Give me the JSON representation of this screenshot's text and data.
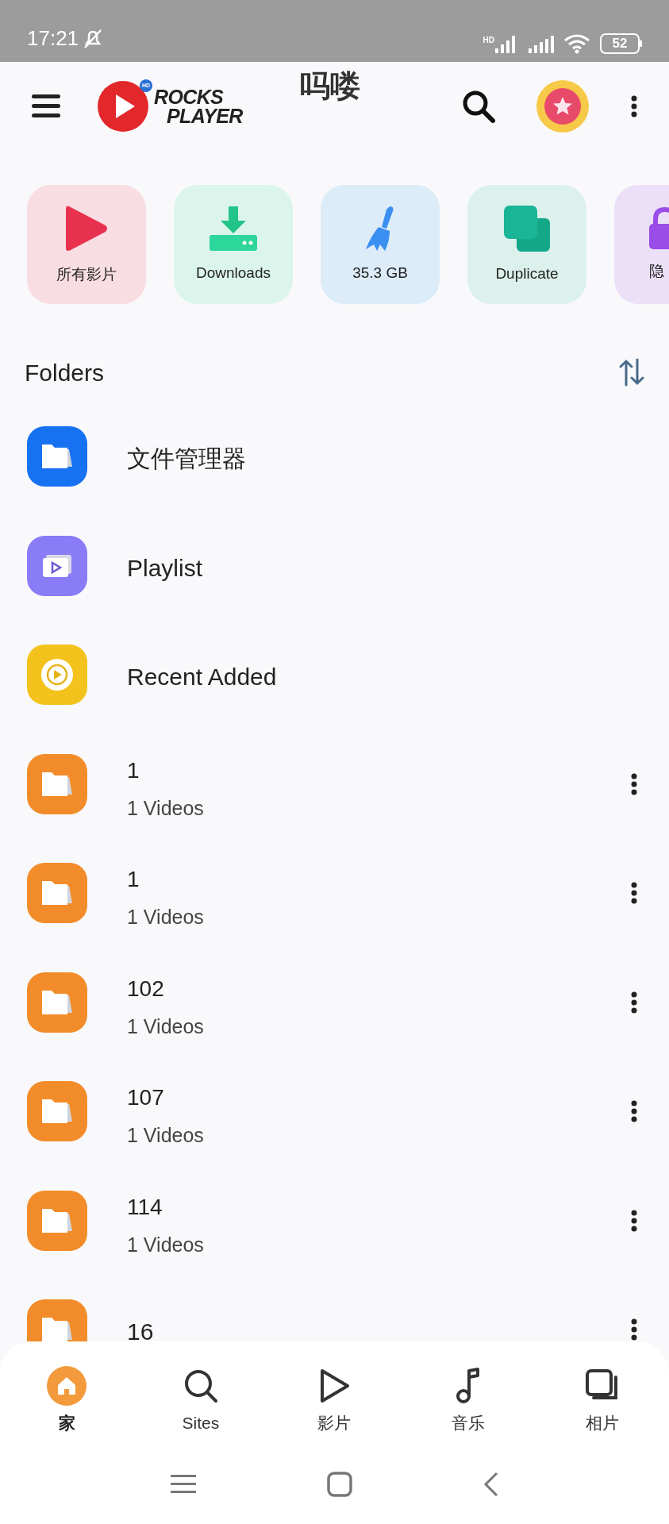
{
  "status_bar": {
    "time": "17:21",
    "battery": "52",
    "network_badge": "HD"
  },
  "header": {
    "logo_badge": "HD",
    "logo_line_1": "ROCKS",
    "logo_line_2": "PLAYER",
    "caption": "吗喽"
  },
  "shortcuts": [
    {
      "kind": "videos",
      "label": "所有影片"
    },
    {
      "kind": "downloads",
      "label": "Downloads"
    },
    {
      "kind": "cleaner",
      "label": "35.3 GB"
    },
    {
      "kind": "duplicate",
      "label": "Duplicate"
    },
    {
      "kind": "private",
      "label": "隐"
    }
  ],
  "folders_title": "Folders",
  "folders": [
    {
      "kind": "file_manager",
      "title": "文件管理器"
    },
    {
      "kind": "playlist",
      "title": "Playlist"
    },
    {
      "kind": "recent",
      "title": "Recent Added"
    },
    {
      "kind": "folder",
      "title": "1",
      "subtitle": "1 Videos"
    },
    {
      "kind": "folder",
      "title": "1",
      "subtitle": "1 Videos"
    },
    {
      "kind": "folder",
      "title": "102",
      "subtitle": "1 Videos"
    },
    {
      "kind": "folder",
      "title": "107",
      "subtitle": "1 Videos"
    },
    {
      "kind": "folder",
      "title": "114",
      "subtitle": "1 Videos"
    },
    {
      "kind": "folder",
      "title": "16"
    }
  ],
  "bottom_nav": [
    {
      "kind": "home",
      "label": "家",
      "selected": true
    },
    {
      "kind": "sites",
      "label": "Sites",
      "selected": false
    },
    {
      "kind": "videos",
      "label": "影片",
      "selected": false
    },
    {
      "kind": "music",
      "label": "音乐",
      "selected": false
    },
    {
      "kind": "photos",
      "label": "相片",
      "selected": false
    }
  ]
}
